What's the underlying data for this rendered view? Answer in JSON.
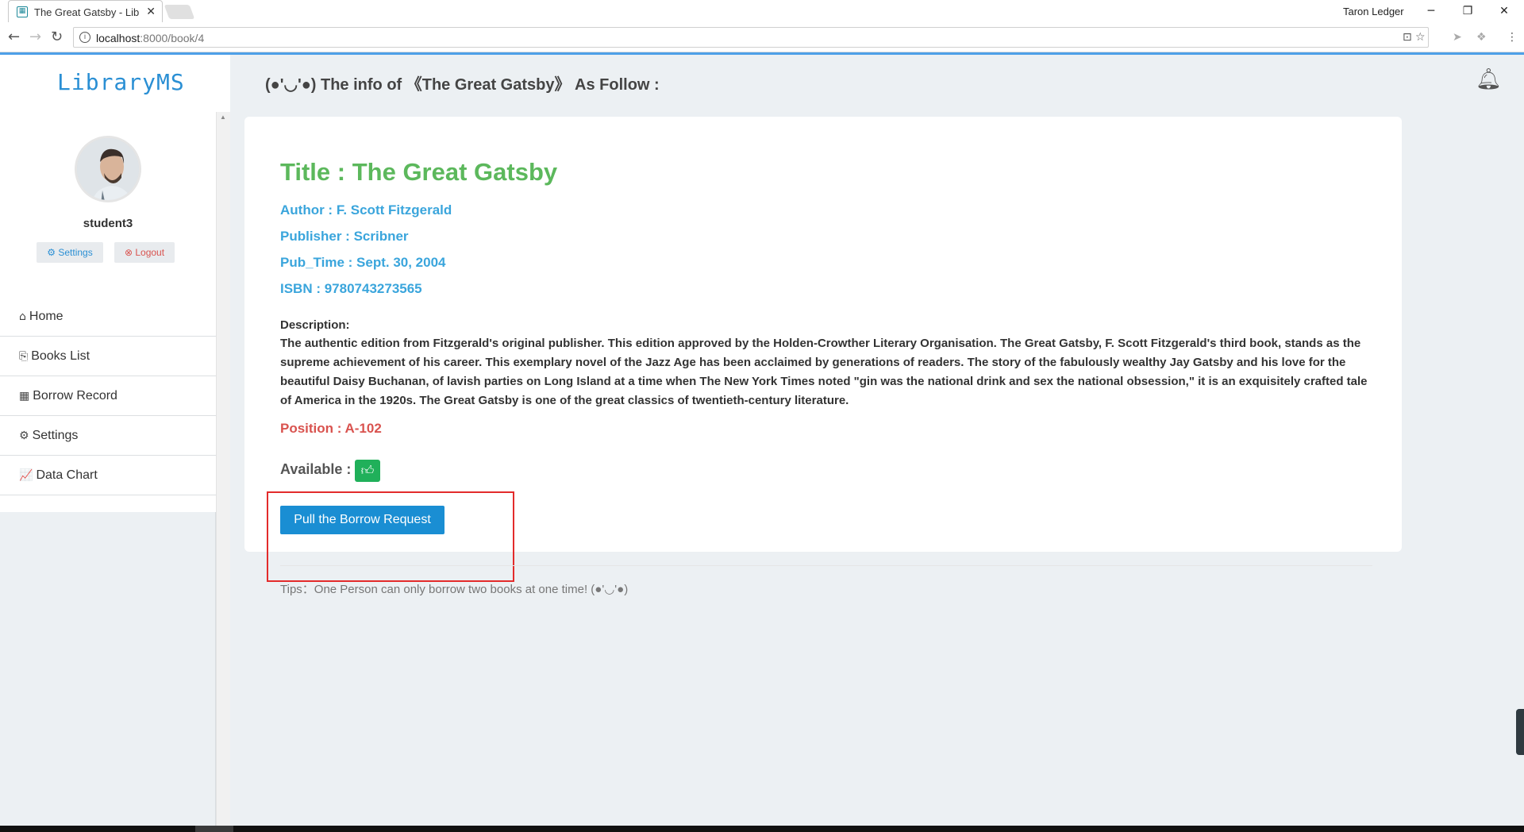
{
  "browser": {
    "tab_title": "The Great Gatsby - Lib",
    "tab_close": "✕",
    "profile_name": "Taron Ledger",
    "url_host": "localhost",
    "url_path": ":8000/book/4"
  },
  "sidebar": {
    "brand": "LibraryMS",
    "username": "student3",
    "settings_btn": "⚙ Settings",
    "logout_btn": "⊗ Logout",
    "menu": [
      {
        "icon": "home-icon",
        "glyph": "⌂",
        "label": "Home"
      },
      {
        "icon": "books-icon",
        "glyph": "⎘",
        "label": "Books List"
      },
      {
        "icon": "table-icon",
        "glyph": "▦",
        "label": "Borrow Record"
      },
      {
        "icon": "gear-icon",
        "glyph": "⚙",
        "label": "Settings"
      },
      {
        "icon": "line-chart-icon",
        "glyph": "📈",
        "label": "Data Chart"
      }
    ]
  },
  "header": {
    "title": "(●'◡'●) The info of 《The Great Gatsby》 As Follow :"
  },
  "book": {
    "title": "Title : The Great Gatsby",
    "author": "Author : F. Scott Fitzgerald",
    "publisher": "Publisher : Scribner",
    "pub_time": "Pub_Time : Sept. 30, 2004",
    "isbn": "ISBN : 9780743273565",
    "description_label": "Description:",
    "description": "The authentic edition from Fitzgerald's original publisher. This edition approved by the Holden-Crowther Literary Organisation. The Great Gatsby, F. Scott Fitzgerald's third book, stands as the supreme achievement of his career. This exemplary novel of the Jazz Age has been acclaimed by generations of readers. The story of the fabulously wealthy Jay Gatsby and his love for the beautiful Daisy Buchanan, of lavish parties on Long Island at a time when The New York Times noted \"gin was the national drink and sex the national obsession,\" it is an exquisitely crafted tale of America in the 1920s. The Great Gatsby is one of the great classics of twentieth-century literature.",
    "position": "Position : A-102",
    "available_label": "Available :",
    "borrow_button": "Pull the Borrow Request",
    "tips": "Tips：One Person can only borrow two books at one time! (●'◡'●)"
  },
  "colors": {
    "brand": "#2a8fd4",
    "title_green": "#5cb85c",
    "meta_blue": "#3aa5dc",
    "position_red": "#d9534f",
    "available_green": "#20b05a",
    "button_blue": "#1a8ed3",
    "highlight_red": "#e32b2b"
  }
}
